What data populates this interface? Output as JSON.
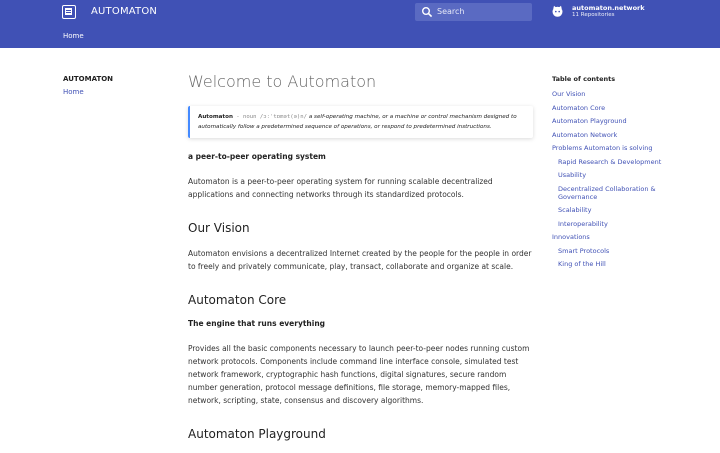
{
  "header": {
    "site_title": "AUTOMATON",
    "search_placeholder": "Search",
    "repo_name": "automaton.network",
    "repo_count": "11 Repositories",
    "tab_home": "Home"
  },
  "nav": {
    "title": "AUTOMATON",
    "items": [
      "Home"
    ]
  },
  "content": {
    "title": "Welcome to Automaton",
    "definition": {
      "term": "Automaton",
      "sep": " - noun ",
      "pronunciation": "/ɔːˈtɒmət(ə)n/",
      "text": " a self-operating machine, or a machine or control mechanism designed to automatically follow a predetermined sequence of operations, or respond to predetermined instructions."
    },
    "tagline": "a peer-to-peer operating system",
    "intro": "Automaton is a peer-to-peer operating system for running scalable decentralized applications and connecting networks through its standardized protocols.",
    "vision_heading": "Our Vision",
    "vision_text": "Automaton envisions a decentralized Internet created by the people for the people in order to freely and privately communicate, play, transact, collaborate and organize at scale.",
    "core_heading": "Automaton Core",
    "core_subhead": "The engine that runs everything",
    "core_text": "Provides all the basic components necessary to launch peer-to-peer nodes running custom network protocols. Components include command line interface console, simulated test network framework, cryptographic hash functions, digital signatures, secure random number generation, protocol message definitions, file storage, memory-mapped files, network, scripting, state, consensus and discovery algorithms.",
    "playground_heading": "Automaton Playground"
  },
  "toc": {
    "title": "Table of contents",
    "items": [
      {
        "label": "Our Vision"
      },
      {
        "label": "Automaton Core"
      },
      {
        "label": "Automaton Playground"
      },
      {
        "label": "Automaton Network"
      },
      {
        "label": "Problems Automaton is solving"
      },
      {
        "label": "Rapid Research & Development"
      },
      {
        "label": "Usability"
      },
      {
        "label": "Decentralized Collaboration & Governance"
      },
      {
        "label": "Scalability"
      },
      {
        "label": "Interoperability"
      },
      {
        "label": "Innovations"
      },
      {
        "label": "Smart Protocols"
      },
      {
        "label": "King of the Hill"
      }
    ]
  },
  "colors": {
    "primary": "#4051b5",
    "link": "#4051b5",
    "admonition_border": "#448aff"
  }
}
